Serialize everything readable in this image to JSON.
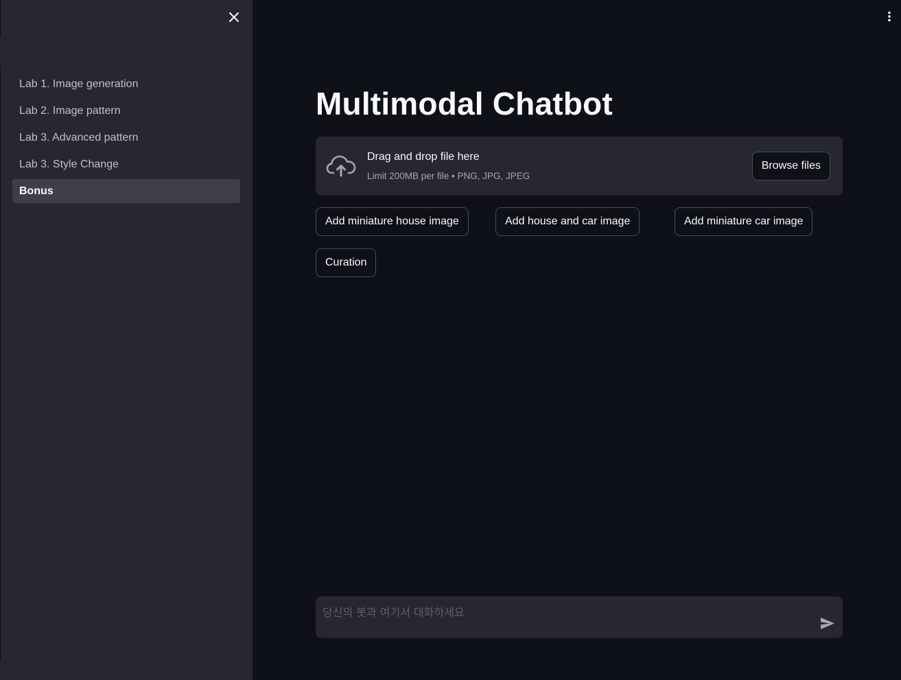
{
  "sidebar": {
    "items": [
      {
        "label": "Lab 1. Image generation",
        "active": false
      },
      {
        "label": "Lab 2. Image pattern",
        "active": false
      },
      {
        "label": "Lab 3. Advanced pattern",
        "active": false
      },
      {
        "label": "Lab 3. Style Change",
        "active": false
      },
      {
        "label": "Bonus",
        "active": true
      }
    ]
  },
  "main": {
    "title": "Multimodal Chatbot",
    "uploader": {
      "title": "Drag and drop file here",
      "subtitle": "Limit 200MB per file • PNG, JPG, JPEG",
      "browse_label": "Browse files"
    },
    "buttons": {
      "miniature_house": "Add miniature house image",
      "house_car": "Add house and car image",
      "miniature_car": "Add miniature car image",
      "curation": "Curation"
    },
    "chat": {
      "placeholder": "당신의 봇과 여기서 대화하세요"
    }
  },
  "icons": {
    "close": "close-icon",
    "menu": "kebab-menu-icon",
    "upload": "cloud-upload-icon",
    "send": "send-icon"
  },
  "colors": {
    "background": "#0e1117",
    "sidebar": "#262730",
    "active_item": "#3d3f4b",
    "text": "#fafafa"
  }
}
